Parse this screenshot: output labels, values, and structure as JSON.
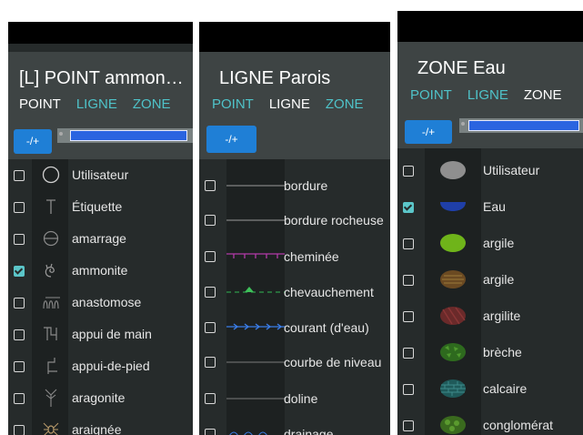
{
  "panel1": {
    "title": "[L] POINT ammon…",
    "tabs": [
      {
        "label": "POINT",
        "active": true
      },
      {
        "label": "LIGNE",
        "active": false
      },
      {
        "label": "ZONE",
        "active": false
      }
    ],
    "pm_label": "-/+",
    "items": [
      {
        "label": "Utilisateur",
        "checked": false,
        "icon": "circle-icon"
      },
      {
        "label": "Étiquette",
        "checked": false,
        "icon": "t-label-icon"
      },
      {
        "label": "amarrage",
        "checked": false,
        "icon": "anchor-circle-icon"
      },
      {
        "label": "ammonite",
        "checked": true,
        "icon": "ammonite-icon"
      },
      {
        "label": "anastomose",
        "checked": false,
        "icon": "anastomose-icon"
      },
      {
        "label": "appui de main",
        "checked": false,
        "icon": "handhold-icon"
      },
      {
        "label": "appui-de-pied",
        "checked": false,
        "icon": "foothold-icon"
      },
      {
        "label": "aragonite",
        "checked": false,
        "icon": "aragonite-icon"
      },
      {
        "label": "araignée",
        "checked": false,
        "icon": "spider-icon"
      }
    ]
  },
  "panel2": {
    "title": "LIGNE Parois",
    "tabs": [
      {
        "label": "POINT",
        "active": false
      },
      {
        "label": "LIGNE",
        "active": true
      },
      {
        "label": "ZONE",
        "active": false
      }
    ],
    "pm_label": "-/+",
    "items": [
      {
        "label": "bordure",
        "checked": false,
        "icon": "plain-line-icon"
      },
      {
        "label": "bordure rocheuse",
        "checked": false,
        "icon": "rock-border-line-icon"
      },
      {
        "label": "cheminée",
        "checked": false,
        "icon": "chimney-line-icon"
      },
      {
        "label": "chevauchement",
        "checked": false,
        "icon": "overlap-line-icon"
      },
      {
        "label": "courant (d'eau)",
        "checked": false,
        "icon": "water-flow-line-icon"
      },
      {
        "label": "courbe de niveau",
        "checked": false,
        "icon": "contour-line-icon"
      },
      {
        "label": "doline",
        "checked": false,
        "icon": "doline-line-icon"
      },
      {
        "label": "drainage",
        "checked": false,
        "icon": "drainage-line-icon"
      }
    ]
  },
  "panel3": {
    "title": "ZONE Eau",
    "tabs": [
      {
        "label": "POINT",
        "active": false
      },
      {
        "label": "LIGNE",
        "active": false
      },
      {
        "label": "ZONE",
        "active": true
      }
    ],
    "pm_label": "-/+",
    "items": [
      {
        "label": "Utilisateur",
        "checked": false,
        "icon": "grey-blob-icon"
      },
      {
        "label": "Eau",
        "checked": true,
        "icon": "water-area-icon"
      },
      {
        "label": "argile",
        "checked": false,
        "icon": "clay-green-icon"
      },
      {
        "label": "argile",
        "checked": false,
        "icon": "clay-brown-icon"
      },
      {
        "label": "argilite",
        "checked": false,
        "icon": "argillite-icon"
      },
      {
        "label": "brèche",
        "checked": false,
        "icon": "breccia-icon"
      },
      {
        "label": "calcaire",
        "checked": false,
        "icon": "limestone-icon"
      },
      {
        "label": "conglomérat",
        "checked": false,
        "icon": "conglomerate-icon"
      }
    ]
  },
  "colors": {
    "tab_inactive": "#4fc3c9",
    "check": "#5bc6c9",
    "button": "#1f7fd6",
    "slider_fill": "#2b64e0"
  }
}
